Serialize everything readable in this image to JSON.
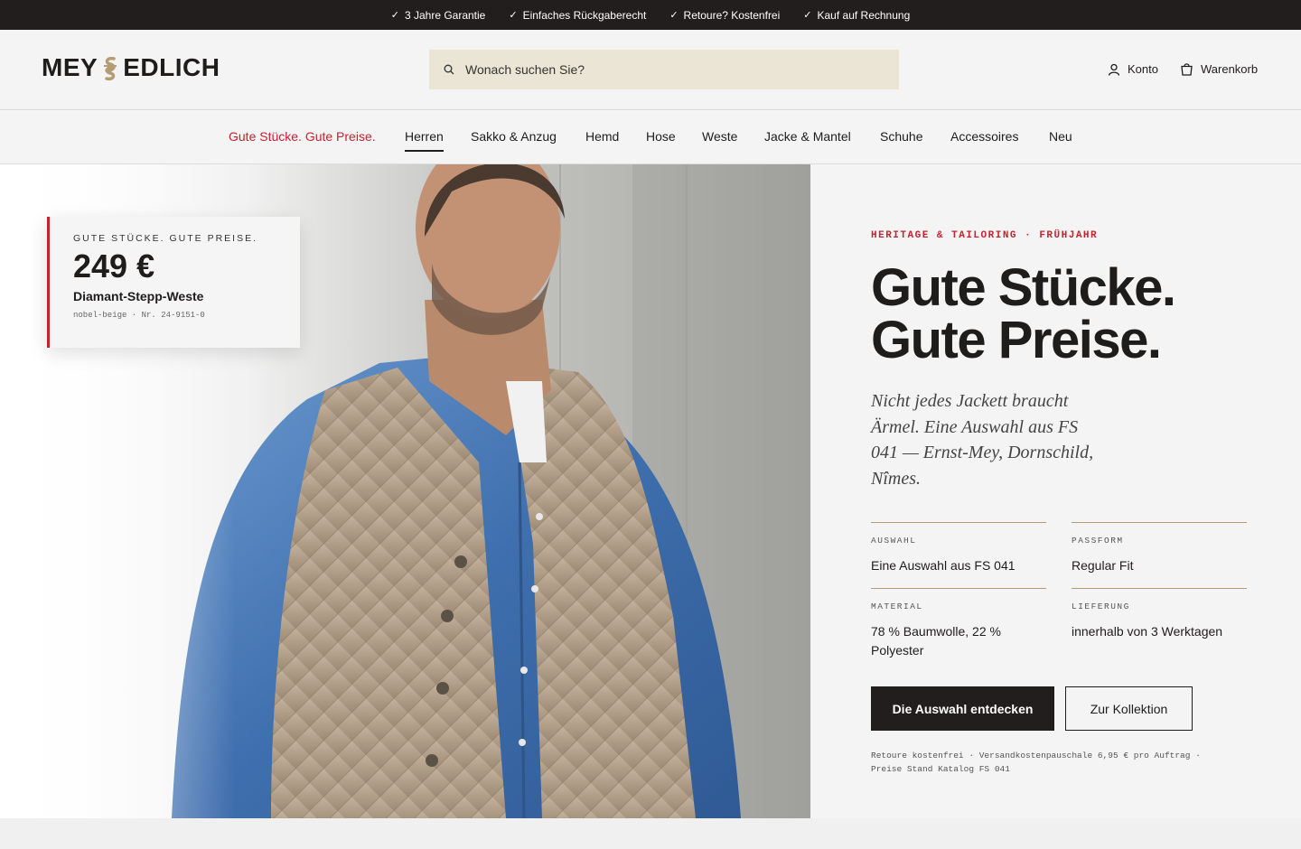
{
  "topbar": {
    "usps": [
      "3 Jahre Garantie",
      "Einfaches Rückgaberecht",
      "Retoure? Kostenfrei",
      "Kauf auf Rechnung"
    ]
  },
  "header": {
    "logo_left": "MEY",
    "logo_right": "EDLICH",
    "search_placeholder": "Wonach suchen Sie?",
    "account_label": "Konto",
    "cart_label": "Warenkorb"
  },
  "nav": {
    "items": [
      "Gute Stücke. Gute Preise.",
      "Herren",
      "Sakko & Anzug",
      "Hemd",
      "Hose",
      "Weste",
      "Jacke & Mantel",
      "Schuhe",
      "Accessoires",
      "Neu"
    ],
    "active": "Herren"
  },
  "price_card": {
    "eyebrow": "GUTE STÜCKE. GUTE PREISE.",
    "price": "249 €",
    "name": "Diamant-Stepp-Weste",
    "meta": "nobel-beige · Nr. 24-9151-0"
  },
  "hero": {
    "kicker": "HERITAGE & TAILORING · FRÜHJAHR",
    "headline_1": "Gute Stücke.",
    "headline_2": "Gute Preise.",
    "intro": "Nicht jedes Jackett braucht Ärmel. Eine Auswahl aus FS 041 — Ernst-Mey, Dornschild, Nîmes.",
    "specs": [
      {
        "label": "AUSWAHL",
        "value": "Eine Auswahl aus FS 041"
      },
      {
        "label": "PASSFORM",
        "value": "Regular Fit"
      },
      {
        "label": "MATERIAL",
        "value": "78 % Baumwolle, 22 % Polyester"
      },
      {
        "label": "LIEFERUNG",
        "value": "innerhalb von 3 Werktagen"
      }
    ],
    "cta_primary": "Die Auswahl entdecken",
    "cta_secondary": "Zur Kollektion",
    "footnote_1": "Retoure kostenfrei · Versandkostenpauschale 6,95 € pro Auftrag ·",
    "footnote_2": "Preise Stand Katalog FS 041"
  },
  "colors": {
    "accent_red": "#c8202e",
    "dark": "#221e1e",
    "search_bg": "#ebe5d6",
    "gold": "#b59c74"
  }
}
